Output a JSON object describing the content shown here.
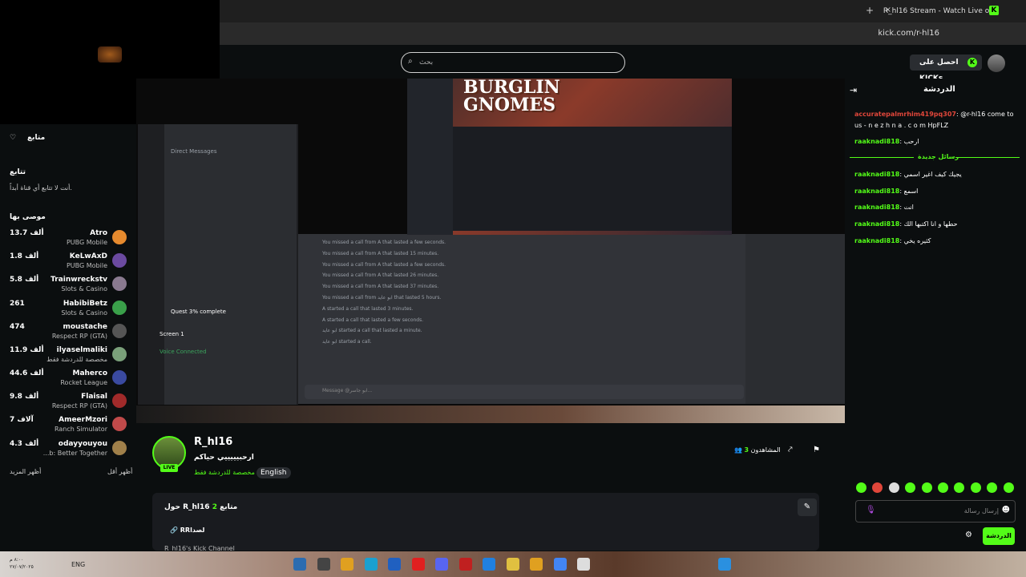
{
  "browser": {
    "tab_title": "R_hl16 Stream - Watch Live on",
    "url": "kick.com/r-hl16",
    "new_tab": "+",
    "close_tab": "×"
  },
  "header": {
    "search_placeholder": "بحث",
    "get_kicks": "احصل على KICKs"
  },
  "sidebar": {
    "following_title": "متابع",
    "following_section": "تتابع",
    "following_empty": "أنت لا تتابع أي قناة أبداً.",
    "recommended_title": "موصى بها",
    "show_more": "أظهر المزيد",
    "show_less": "أظهر أقل",
    "channels": [
      {
        "name": "Atro",
        "category": "PUBG Mobile",
        "viewers": "13.7 ألف",
        "color": "#e68a2e"
      },
      {
        "name": "KeLwAxD",
        "category": "PUBG Mobile",
        "viewers": "1.8 ألف",
        "color": "#6b4aa0"
      },
      {
        "name": "Trainwreckstv",
        "category": "Slots & Casino",
        "viewers": "5.8 ألف",
        "color": "#8a7a90"
      },
      {
        "name": "HabibiBetz",
        "category": "Slots & Casino",
        "viewers": "261",
        "color": "#3aa04a"
      },
      {
        "name": "moustache",
        "category": "Respect RP (GTA)",
        "viewers": "474",
        "color": "#555555"
      },
      {
        "name": "ilyaselmaliki",
        "category": "مخصصة للدردشة فقط",
        "viewers": "11.9 ألف",
        "color": "#7aa07a"
      },
      {
        "name": "Maherco",
        "category": "Rocket League",
        "viewers": "44.6 ألف",
        "color": "#3a4aa0"
      },
      {
        "name": "Flaisal",
        "category": "Respect RP (GTA)",
        "viewers": "9.8 ألف",
        "color": "#a02a2a"
      },
      {
        "name": "AmeerMzori",
        "category": "Ranch Simulator",
        "viewers": "7 آلاف",
        "color": "#c04a4a"
      },
      {
        "name": "odayyouyou",
        "category": "...b: Better Together",
        "viewers": "4.3 ألف",
        "color": "#a0804a"
      }
    ]
  },
  "stream": {
    "game_title": "BURGLIN GNOMES",
    "streamer": "R_hl16",
    "live": "LIVE",
    "title": "ارحبيييييي حياكم",
    "category": "مخصصة للدردشة فقط",
    "language": "English",
    "viewers_label": "المشاهدون",
    "viewers_count": "3",
    "about_title": "حول R_hl16",
    "followers_label": "متابع",
    "followers_count": "2",
    "rr": "RRلصدا",
    "channel_desc": "R_hl16's Kick Channel",
    "discord_quest": "Quest 3% complete",
    "discord_screen": "Screen 1",
    "discord_voice": "Voice Connected",
    "discord_input": "Message @ابو جاسر..."
  },
  "discord_calls": [
    "You missed a call from A that lasted a few seconds.",
    "You missed a call from A that lasted 15 minutes.",
    "You missed a call from A that lasted a few seconds.",
    "You missed a call from A that lasted 26 minutes.",
    "You missed a call from A that lasted 37 minutes.",
    "You missed a call from ابو عايد that lasted 5 hours.",
    "A started a call that lasted 3 minutes.",
    "A started a call that lasted a few seconds.",
    "ابو عايد started a call that lasted a minute.",
    "ابو عايد started a call."
  ],
  "chat": {
    "title": "الدردشة",
    "new_messages": "رسائل جديدة",
    "messages": [
      {
        "user": "accuratepalmrhim419pq307",
        "text": "@r-hl16 come to us - n e z h n a . c o m HpFLZ",
        "spam": true
      },
      {
        "user": "raaknadi818",
        "text": "ارحب"
      },
      {
        "user": "raaknadi818",
        "text": "يجيك كيف اغير اسمي"
      },
      {
        "user": "raaknadi818",
        "text": "اسمع"
      },
      {
        "user": "raaknadi818",
        "text": "انت"
      },
      {
        "user": "raaknadi818",
        "text": "حطها و انا اكتبها الك"
      },
      {
        "user": "raaknadi818",
        "text": "كثيره يخي"
      }
    ],
    "input_placeholder": "إرسال رسالة",
    "send_label": "الدردشة"
  },
  "taskbar": {
    "lang": "ENG",
    "time": "٨:٠٠ م",
    "date": "٢٧/٠٧/٢٠٢٥"
  }
}
